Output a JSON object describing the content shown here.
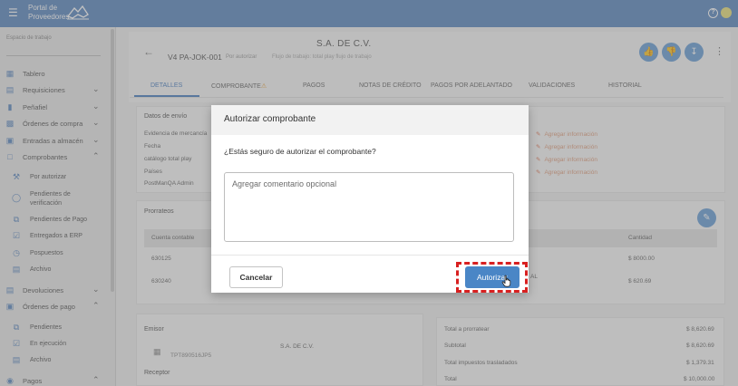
{
  "topbar": {
    "brand_line1": "Portal de",
    "brand_line2": "Proveedores",
    "colors": {
      "bar": "#5c88c0",
      "avatar": "#e8e07a"
    }
  },
  "sidebar": {
    "workspace_label": "Espacio de trabajo",
    "items": [
      {
        "label": "Tablero",
        "icon": "dashboard-icon"
      },
      {
        "label": "Requisiciones",
        "icon": "list-icon"
      },
      {
        "label": "Peñafiel",
        "icon": "bottle-icon"
      },
      {
        "label": "Órdenes de compra",
        "icon": "cart-icon"
      },
      {
        "label": "Entradas a almacén",
        "icon": "truck-icon"
      },
      {
        "label": "Comprobantes",
        "icon": "document-icon"
      }
    ],
    "comprobantes_sub": [
      {
        "label": "Por autorizar",
        "icon": "gavel-icon"
      },
      {
        "label": "Pendientes de verificación",
        "icon": "shield-icon"
      },
      {
        "label": "Pendientes de Pago",
        "icon": "copy-icon"
      },
      {
        "label": "Entregados a ERP",
        "icon": "check-doc-icon"
      },
      {
        "label": "Pospuestos",
        "icon": "clock-icon"
      },
      {
        "label": "Archivo",
        "icon": "archive-icon"
      }
    ],
    "items2": [
      {
        "label": "Devoluciones",
        "icon": "return-icon"
      },
      {
        "label": "Órdenes de pago",
        "icon": "payment-icon"
      }
    ],
    "pago_sub": [
      {
        "label": "Pendientes",
        "icon": "copy-icon"
      },
      {
        "label": "En ejecución",
        "icon": "check-doc-icon"
      },
      {
        "label": "Archivo",
        "icon": "archive-icon"
      }
    ],
    "items3": [
      {
        "label": "Pagos",
        "icon": "money-icon"
      }
    ]
  },
  "header": {
    "doc_id": "V4 PA-JOK-001",
    "doc_status": "Por autorizar",
    "doc_flow": "Flujo de trabajo: total play flujo de trabajo",
    "company": "S.A. DE C.V."
  },
  "tabs": [
    "DETALLES",
    "COMPROBANTE",
    "PAGOS",
    "NOTAS DE CRÉDITO",
    "PAGOS POR ADELANTADO",
    "VALIDACIONES",
    "HISTORIAL"
  ],
  "sending": {
    "title": "Datos de envío",
    "fields": [
      "Evidencia de mercancía",
      "Fecha",
      "catálogo total play",
      "Países",
      "PostManQA Admin"
    ],
    "add_info": "Agregar información"
  },
  "prorrateos": {
    "title": "Prorrateos",
    "col_cuenta": "Cuenta contable",
    "col_cantidad": "Cantidad",
    "rows": [
      {
        "cuenta": "630125",
        "fragment": "",
        "cantidad": "$ 8000.00"
      },
      {
        "cuenta": "630240",
        "fragment": "AL",
        "cantidad": "$ 620.69"
      }
    ]
  },
  "emisor": {
    "title": "Emisor",
    "rfc": "TPT890516JP5",
    "name": "S.A. DE C.V.",
    "receptor_title": "Receptor"
  },
  "totals": [
    {
      "label": "Total a prorratear",
      "value": "$ 8,620.69"
    },
    {
      "label": "Subtotal",
      "value": "$ 8,620.69"
    },
    {
      "label": "Total impuestos trasladados",
      "value": "$ 1,379.31"
    },
    {
      "label": "Total",
      "value": "$ 10,000.00"
    }
  ],
  "modal": {
    "title": "Autorizar comprobante",
    "question": "¿Estás seguro de autorizar el comprobante?",
    "comment_placeholder": "Agregar comentario opcional",
    "comment_value": "",
    "cancel_label": "Cancelar",
    "authorize_label": "Autorizar",
    "colors": {
      "authorize": "#4a86c6",
      "highlight": "#d82020"
    }
  }
}
